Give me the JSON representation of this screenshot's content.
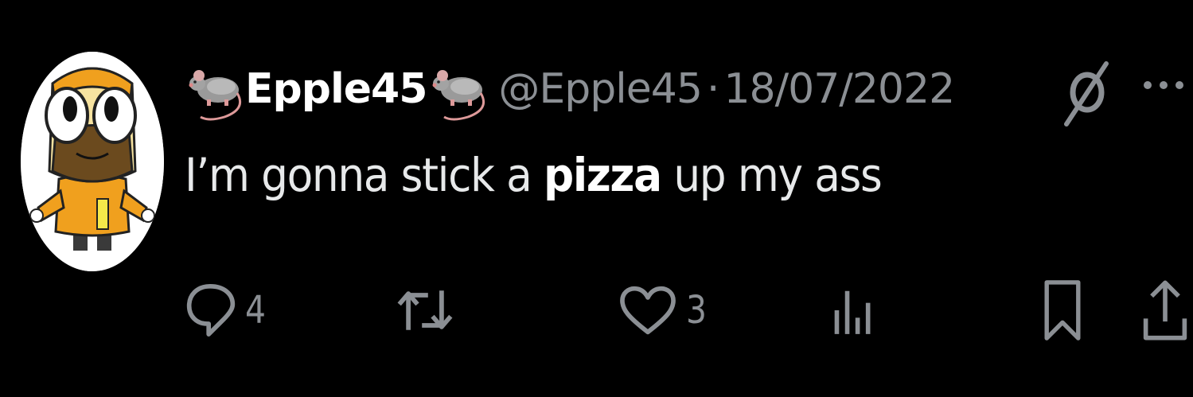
{
  "tweet": {
    "display_name": "Epple45",
    "name_emoji_left": "rat-icon",
    "name_emoji_right": "rat-icon",
    "handle": "@Epple45",
    "separator": "·",
    "date": "18/07/2022",
    "text_before": "I’m gonna stick a ",
    "text_bold": "pizza",
    "text_after": " up my ass"
  },
  "actions": {
    "reply_count": "4",
    "like_count": "3"
  },
  "icons": {
    "avatar": "cartoon-avatar",
    "verified": "slashed-circle-icon",
    "more": "more-dots-icon",
    "reply": "reply-icon",
    "retweet": "retweet-icon",
    "like": "heart-icon",
    "views": "views-bar-chart-icon",
    "bookmark": "bookmark-icon",
    "share": "share-icon"
  },
  "colors": {
    "background": "#000000",
    "primary_text": "#e7e9ea",
    "secondary_text": "#8b8f94"
  }
}
